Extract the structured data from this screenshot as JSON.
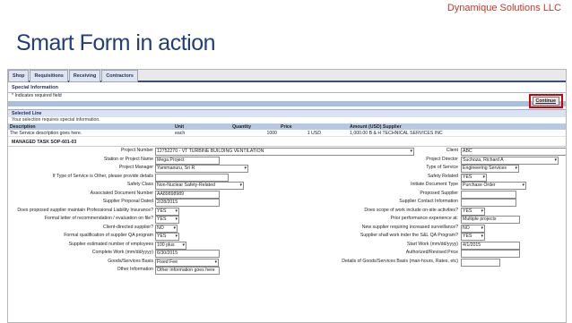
{
  "brand": "Dynamique Solutions LLC",
  "slide_title": "Smart Form in action",
  "tabs": [
    "Shop",
    "Requisitions",
    "Receiving",
    "Contractors"
  ],
  "special_info": {
    "title": "Special Information",
    "required_note": "* Indicates required field",
    "continue_label": "Continue"
  },
  "selected_line": {
    "title": "Selected Line",
    "message": "Your selection requires special information.",
    "headers": [
      "Description",
      "Unit",
      "Quantity",
      "Price",
      "Amount (USD) Supplier"
    ],
    "row": [
      "The Service description goes here.",
      "each",
      "1000",
      "1 USD",
      "1,000.00 B & H TECHNICAL SERVICES INC"
    ]
  },
  "task_title": "MANAGED TASK SOP-601-03",
  "left_fields": [
    {
      "label": "Project Number",
      "value": "12752270 - VT TURBINE BUILDING VENTILATION",
      "select": true
    },
    {
      "label": "Station or Project Name",
      "value": "Mega Project",
      "select": false
    },
    {
      "label": "Project Manager",
      "value": "Yammanuru, Sri R",
      "select": true
    },
    {
      "label": "If Type of Service is Other, please provide details",
      "value": "",
      "select": false
    },
    {
      "label": "Safety Class",
      "value": "Non-Nuclear Safety-Related",
      "select": true
    },
    {
      "label": "Associated Document Number",
      "value": "AA89898989",
      "select": false
    },
    {
      "label": "Supplier Proposal Dated",
      "value": "2/28/2015",
      "select": false
    },
    {
      "label": "Does proposed supplier maintain Professional Liability Insurance?",
      "value": "YES",
      "select": true
    },
    {
      "label": "Formal letter of recommendation / evaluation on file?",
      "value": "YES",
      "select": true
    },
    {
      "label": "Client-directed supplier?",
      "value": "NO",
      "select": true
    },
    {
      "label": "Formal qualification of supplier QA program",
      "value": "YES",
      "select": true
    },
    {
      "label": "Supplier estimated number of employees",
      "value": "100 plus",
      "select": true
    },
    {
      "label": "Complete Work (mm/dd/yyyy)",
      "value": "6/30/2015",
      "select": false
    },
    {
      "label": "Goods/Services Basis",
      "value": "Fixed Fee",
      "select": true
    },
    {
      "label": "Other Information",
      "value": "Other information goes here",
      "select": false
    }
  ],
  "right_fields": [
    {
      "label": "Client",
      "value": "ABC",
      "select": true
    },
    {
      "label": "Project Director",
      "value": "Suchoza, Richard A",
      "select": true
    },
    {
      "label": "Type of Service",
      "value": "Engineering Services",
      "select": true
    },
    {
      "label": "Safety Related",
      "value": "YES",
      "select": true
    },
    {
      "label": "Initiate Document Type",
      "value": "Purchase Order",
      "select": true
    },
    {
      "label": "Proposed Supplier",
      "value": "",
      "select": false
    },
    {
      "label": "Supplier Contact Information",
      "value": "",
      "select": false
    },
    {
      "label": "Does scope of work include on-site activities?",
      "value": "YES",
      "select": true
    },
    {
      "label": "Prior performance experience at:",
      "value": "Multiple projects",
      "select": false
    },
    {
      "label": "New supplier requiring increased surveillance?",
      "value": "NO",
      "select": true
    },
    {
      "label": "Supplier shall work inder the S&L QA Program?",
      "value": "YES",
      "select": true
    },
    {
      "label": "Start Work (mm/dd/yyyy)",
      "value": "4/1/2015",
      "select": false
    },
    {
      "label": "Authorized/Revised Price",
      "value": "",
      "select": false
    },
    {
      "label": "Details of Goods/Services Basis (man-hours, Rates, etc)",
      "value": "",
      "select": false
    },
    {
      "label": "",
      "value": "",
      "select": false
    }
  ]
}
